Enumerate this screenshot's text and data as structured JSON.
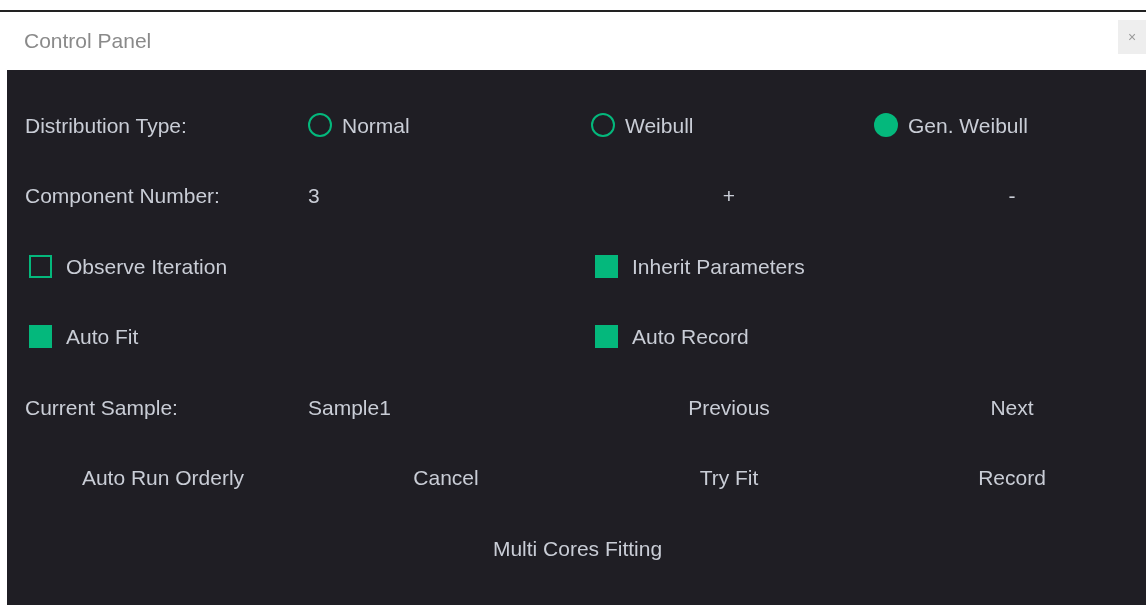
{
  "window": {
    "title": "Control Panel",
    "close": "×"
  },
  "distribution": {
    "label": "Distribution Type:",
    "options": [
      {
        "label": "Normal",
        "selected": false
      },
      {
        "label": "Weibull",
        "selected": false
      },
      {
        "label": "Gen. Weibull",
        "selected": true
      }
    ]
  },
  "component": {
    "label": "Component Number:",
    "value": "3",
    "buttons": [
      "+",
      "-"
    ]
  },
  "checkboxes": [
    {
      "label": "Observe Iteration",
      "checked": false
    },
    {
      "label": "Inherit Parameters",
      "checked": true
    },
    {
      "label": "Auto Fit",
      "checked": true
    },
    {
      "label": "Auto Record",
      "checked": true
    }
  ],
  "sample": {
    "label": "Current Sample:",
    "value": "Sample1",
    "buttons": [
      "Previous",
      "Next"
    ]
  },
  "actions": [
    "Auto Run Orderly",
    "Cancel",
    "Try Fit",
    "Record"
  ],
  "footer_button": "Multi Cores Fitting"
}
